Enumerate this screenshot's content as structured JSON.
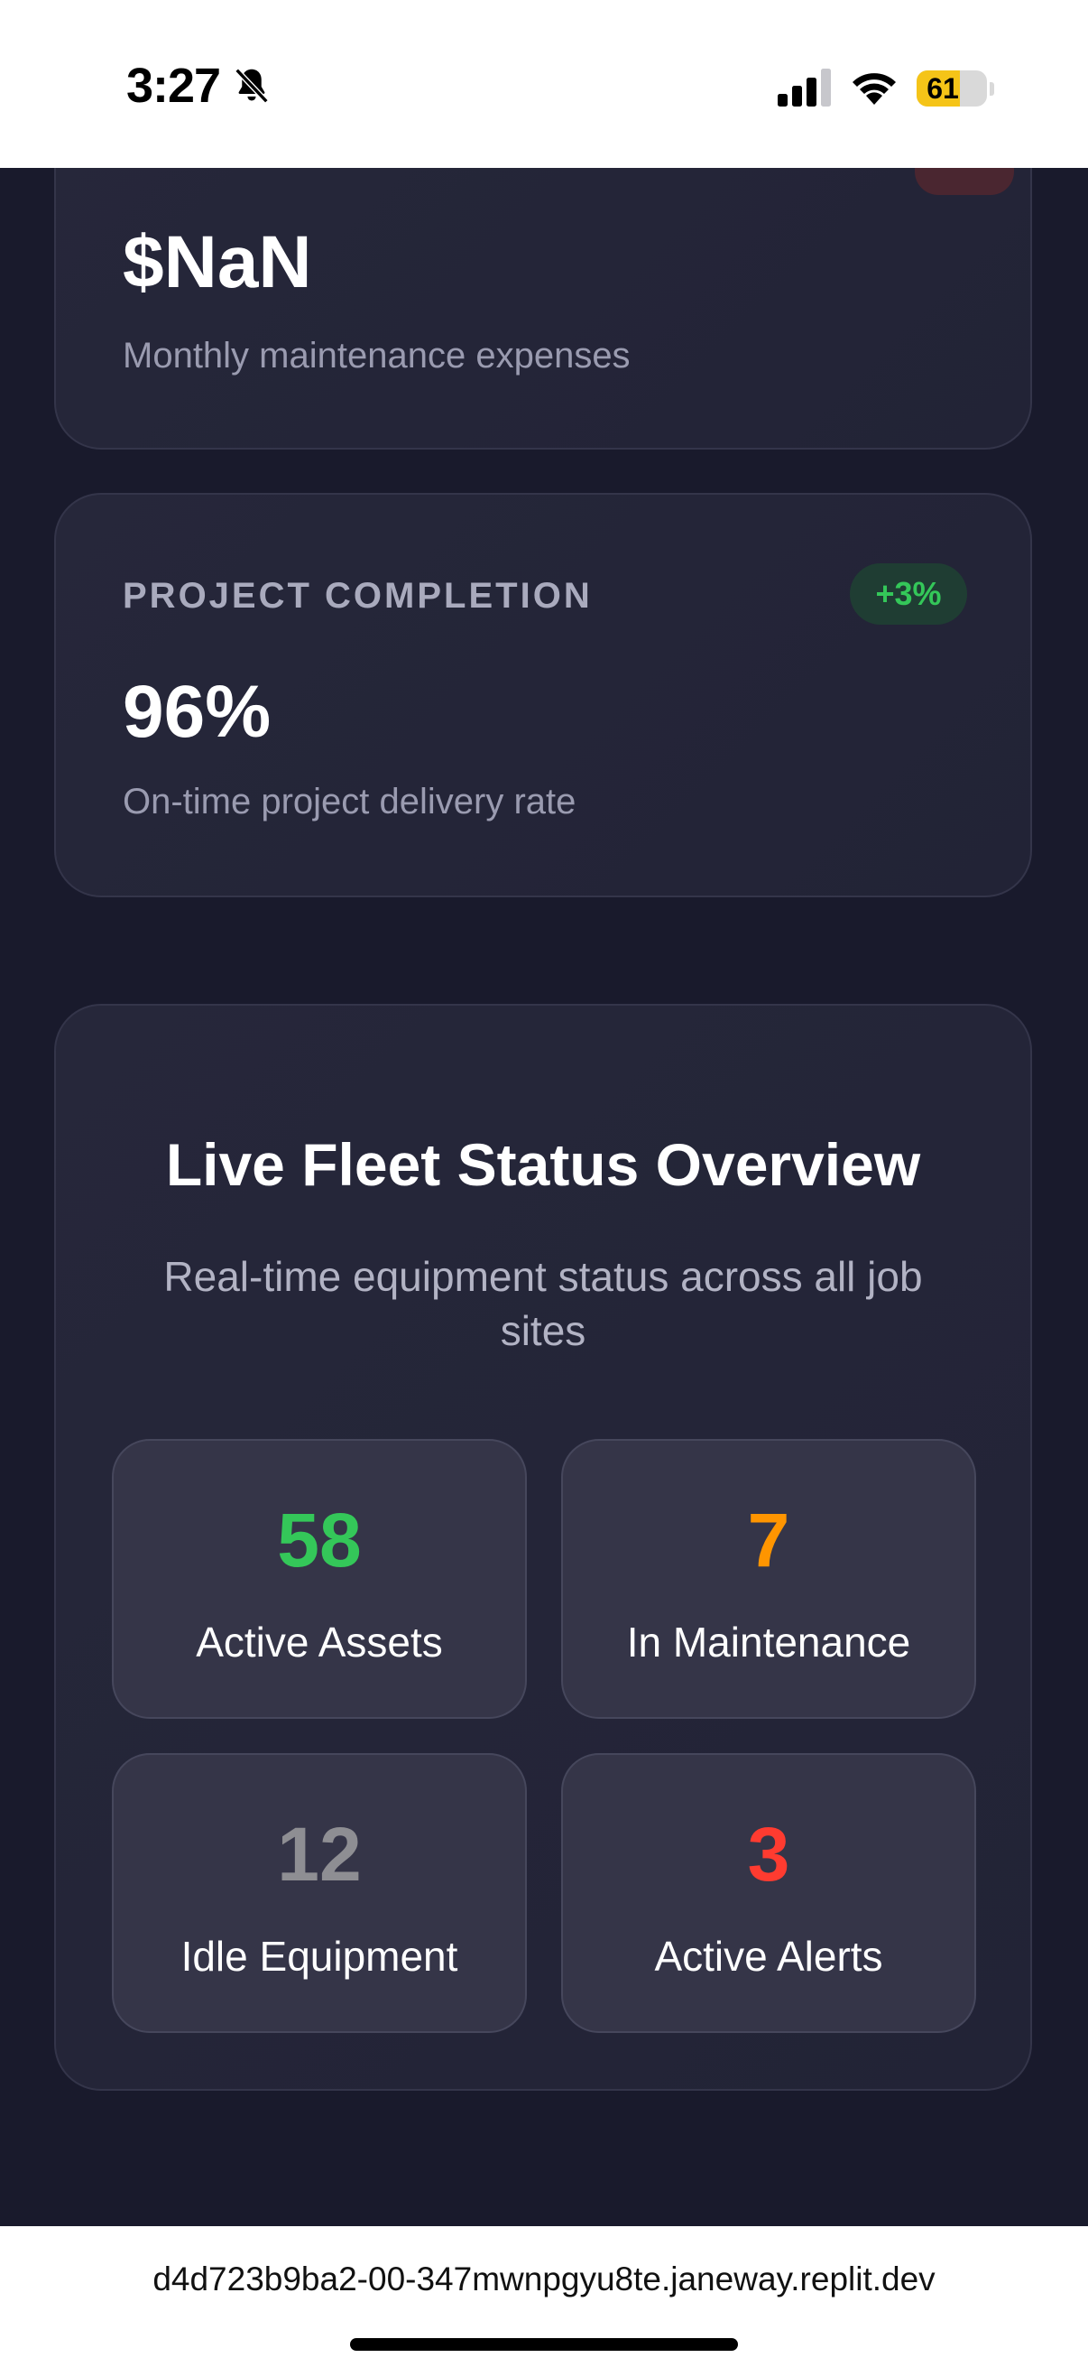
{
  "status_bar": {
    "time": "3:27",
    "battery": "61",
    "battery_color": "#f5c418"
  },
  "expenses_card": {
    "value": "$NaN",
    "description": "Monthly maintenance expenses"
  },
  "completion_card": {
    "label": "PROJECT COMPLETION",
    "trend": "+3%",
    "value": "96%",
    "description": "On-time project delivery rate"
  },
  "fleet": {
    "title": "Live Fleet Status Overview",
    "subtitle": "Real-time equipment status across all job sites",
    "stats": [
      {
        "value": "58",
        "label": "Active Assets",
        "color": "#34c759"
      },
      {
        "value": "7",
        "label": "In Maintenance",
        "color": "#ff9500"
      },
      {
        "value": "12",
        "label": "Idle Equipment",
        "color": "#8e8e93"
      },
      {
        "value": "3",
        "label": "Active Alerts",
        "color": "#ff3b30"
      }
    ]
  },
  "browser": {
    "url": "d4d723b9ba2-00-347mwnpgyu8te.janeway.replit.dev"
  }
}
